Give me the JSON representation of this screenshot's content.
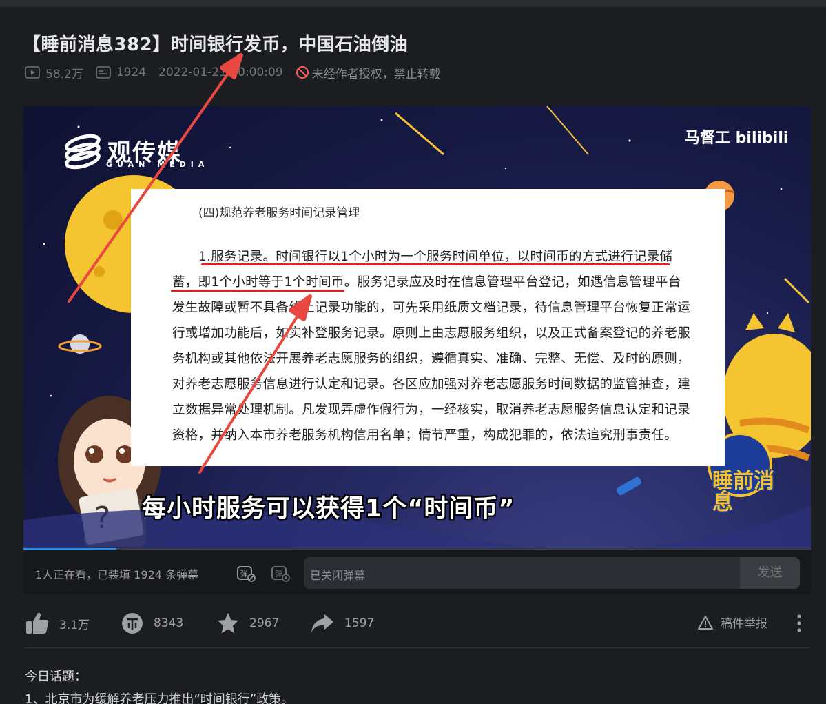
{
  "video": {
    "title": "【睡前消息382】时间银行发币，中国石油倒油",
    "views": "58.2万",
    "danmaku_count": "1924",
    "publish_time": "2022-01-21 20:00:09",
    "copyright": "未经作者授权，禁止转载"
  },
  "player": {
    "logo_text": "观传媒",
    "logo_sub": "GUAN MEDIA",
    "brand": "马督工 bilibili",
    "doc_heading": "(四)规范养老服务时间记录管理",
    "doc_lines": [
      "1.服务记录。时间银行以1个小时为一个服务时间单位，以时间币的方式进行记录储",
      "蓄，即1个小时等于1个时间币。服务记录应及时在信息管理平台登记，如遇信息管理平台",
      "发生故障或暂不具备线上记录功能的，可先采用纸质文档记录，待信息管理平台恢复正常运",
      "行或增加功能后，如实补登服务记录。原则上由志愿服务组织，以及正式备案登记的养老服",
      "务机构或其他依法开展养老志愿服务的组织，遵循真实、准确、完整、无偿、及时的原则，",
      "对养老志愿服务信息进行认定和记录。各区应加强对养老志愿服务时间数据的监管抽查，建",
      "立数据异常处理机制。凡发现弄虚作假行为，一经核实，取消养老志愿服务信息认定和记录",
      "资格，并纳入本市养老服务机构信用名单；情节严重，构成犯罪的，依法追究刑事责任。"
    ],
    "subtitle": "每小时服务可以获得1个“时间币”",
    "badge": "睡前消息",
    "progress": 0.118
  },
  "controls": {
    "watching": "1人正在看，已装填 1924 条弹幕",
    "danmaku_placeholder": "已关闭弹幕",
    "send_label": "发送"
  },
  "actions": {
    "like": "3.1万",
    "coin": "8343",
    "favorite": "2967",
    "share": "1597",
    "report": "稿件举报"
  },
  "description": {
    "line1": "今日话题：",
    "line2": "1、北京市为缓解养老压力推出“时间银行”政策。"
  },
  "colors": {
    "background": "#1c1d21",
    "accent_red": "#e02020",
    "progress_blue": "#2f8fd8"
  }
}
